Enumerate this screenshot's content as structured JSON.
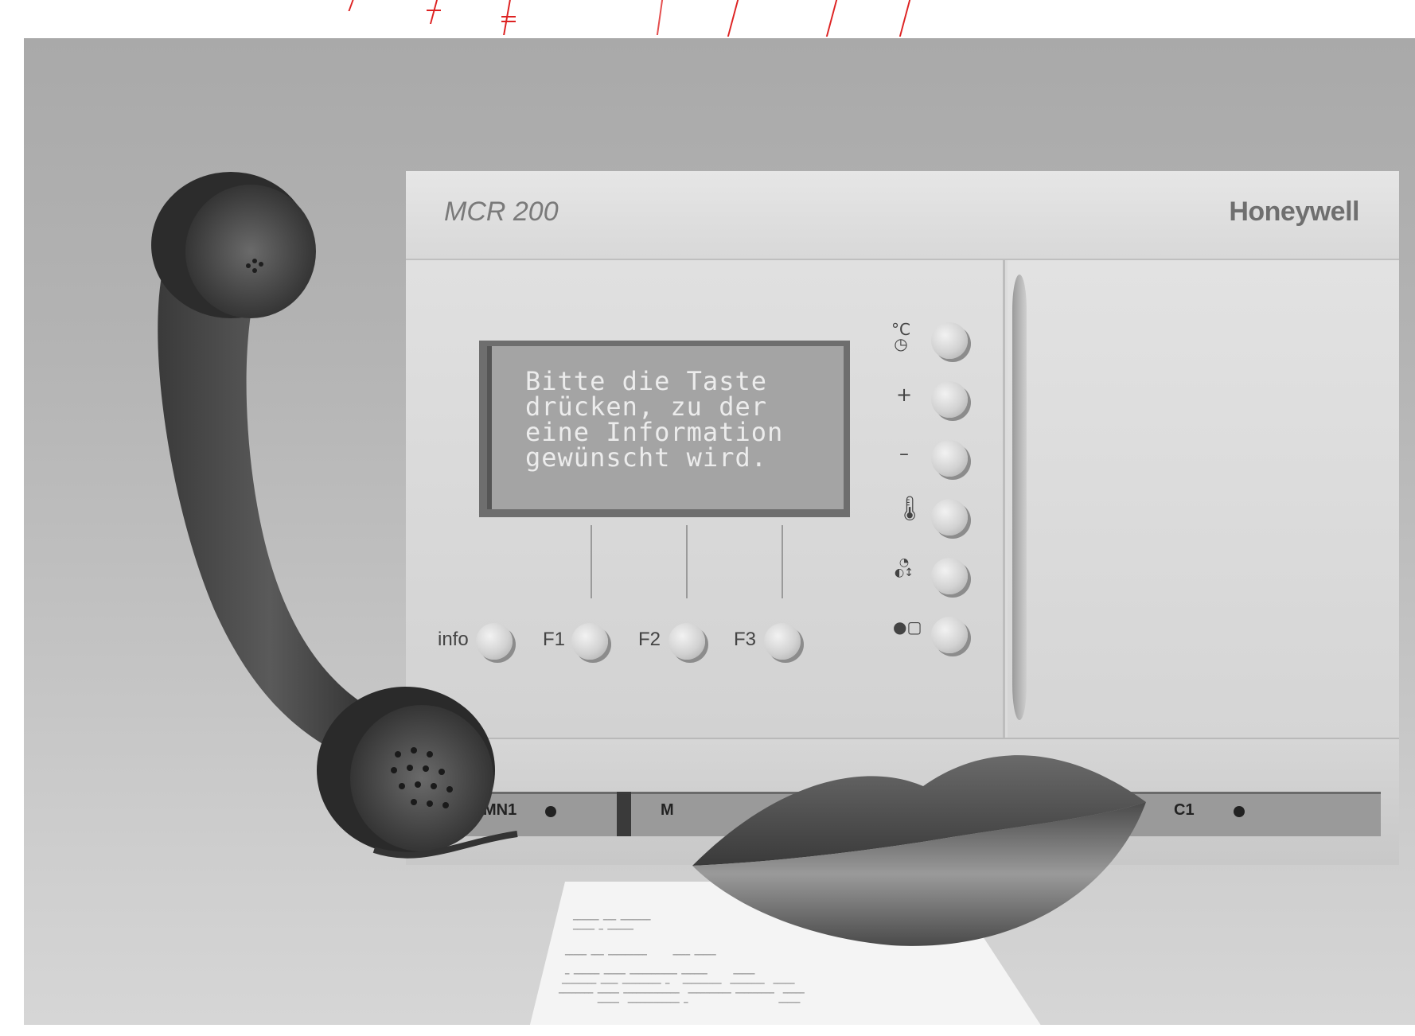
{
  "device": {
    "model": "MCR 200",
    "brand": "Honeywell"
  },
  "lcd": {
    "lines": [
      "Bitte die Taste",
      "drücken, zu der",
      "eine Information",
      "gewünscht wird."
    ]
  },
  "buttons": {
    "info": "info",
    "f1": "F1",
    "f2": "F2",
    "f3": "F3",
    "plus": "+",
    "minus": "–",
    "celsius": "°C"
  },
  "modules": {
    "left": "MN1",
    "middle": "M",
    "right": "C1"
  },
  "colors": {
    "accent_red": "#d22222",
    "background_gray": "#b3b3b3",
    "lcd_gray": "#a4a4a4"
  }
}
